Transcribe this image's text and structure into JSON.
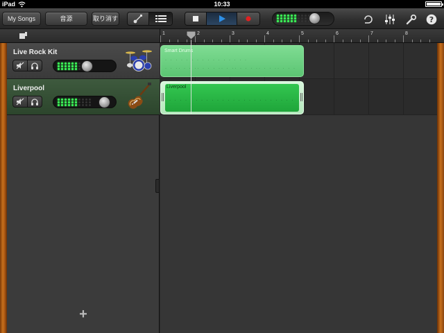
{
  "status_bar": {
    "device": "iPad",
    "time": "10:33"
  },
  "toolbar": {
    "my_songs_label": "My Songs",
    "instrument_label": "音源",
    "undo_label": "取り消す",
    "colors": {
      "play_active": "#2e8fe6",
      "record": "#e02020",
      "led_on": "#3dff5a"
    }
  },
  "ruler": {
    "bars": [
      "1",
      "2",
      "3",
      "4",
      "5",
      "6",
      "7",
      "8"
    ]
  },
  "tracks": [
    {
      "name": "Live Rock Kit",
      "region_name": "Smart Drums",
      "level_leds_on": 6,
      "volume": 0.55,
      "icon": "drum-kit-icon",
      "region_color": "#6fd284"
    },
    {
      "name": "Liverpool",
      "region_name": "Liverpool",
      "level_leds_on": 6,
      "volume": 0.9,
      "icon": "bass-guitar-icon",
      "region_color": "#2cba48",
      "selected": true
    }
  ],
  "add_track_label": "+"
}
